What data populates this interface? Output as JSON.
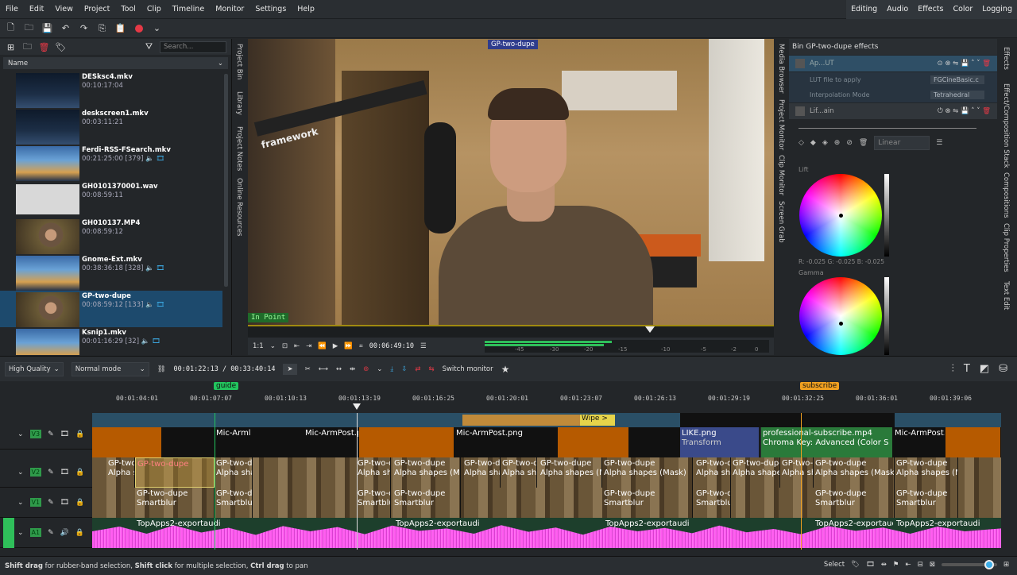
{
  "menu": [
    "File",
    "Edit",
    "View",
    "Project",
    "Tool",
    "Clip",
    "Timeline",
    "Monitor",
    "Settings",
    "Help"
  ],
  "layouts": [
    "Editing",
    "Audio",
    "Effects",
    "Color",
    "Logging"
  ],
  "bin": {
    "search_placeholder": "Search...",
    "name_header": "Name",
    "clips": [
      {
        "name": "DESksc4.mkv",
        "dur": "00:10:17:04",
        "extra": ""
      },
      {
        "name": "deskscreen1.mkv",
        "dur": "00:03:11:21",
        "extra": ""
      },
      {
        "name": "Ferdi-RSS-FSearch.mkv",
        "dur": "00:21:25:00 [379]",
        "extra": "🔈 🎞"
      },
      {
        "name": "GH0101370001.wav",
        "dur": "00:08:59:11",
        "extra": ""
      },
      {
        "name": "GH010137.MP4",
        "dur": "00:08:59:12",
        "extra": ""
      },
      {
        "name": "Gnome-Ext.mkv",
        "dur": "00:38:36:18 [328]",
        "extra": "🔈 🎞"
      },
      {
        "name": "GP-two-dupe",
        "dur": "00:08:59:12 [133]",
        "extra": "🔈 🎞"
      },
      {
        "name": "Ksnip1.mkv",
        "dur": "00:01:16:29 [32]",
        "extra": "🔈 🎞"
      }
    ]
  },
  "left_tabs": [
    "Project Bin",
    "Library",
    "Project Notes",
    "Online Resources"
  ],
  "mid_tabs": [
    "Media Browser",
    "Project Monitor",
    "Clip Monitor",
    "Screen Grab"
  ],
  "right_tabs": [
    "Effects",
    "Effect/Composition Stack",
    "Compositions",
    "Clip Properties",
    "Text Edit"
  ],
  "monitor": {
    "clip_label": "GP-two-dupe",
    "in_point": "In Point",
    "overlay_text": "framework",
    "zoom": "1:1",
    "timecode": "00:06:49:10",
    "meter_scale": [
      "-45",
      "-30",
      "-20",
      "-15",
      "-10",
      "-5",
      "-2",
      "0"
    ]
  },
  "effects": {
    "title": "Bin GP-two-dupe effects",
    "effect1": "Ap...UT",
    "lut_label": "LUT file to apply",
    "lut_value": "FGCineBasic.c",
    "interp_label": "Interpolation Mode",
    "interp_value": "Tetrahedral",
    "effect2": "Lif...ain",
    "mode": "Linear",
    "lift_label": "Lift",
    "lift_values": "R: -0.025  G: -0.025  B: -0.025",
    "gamma_label": "Gamma"
  },
  "timeline_toolbar": {
    "quality": "High Quality",
    "mode": "Normal mode",
    "position": "00:01:22:13 / 00:33:40:14",
    "switch_monitor": "Switch monitor"
  },
  "ruler": {
    "ticks": [
      "00:01:04:01",
      "00:01:07:07",
      "00:01:10:13",
      "00:01:13:19",
      "00:01:16:25",
      "00:01:20:01",
      "00:01:23:07",
      "00:01:26:13",
      "00:01:29:19",
      "00:01:32:25",
      "00:01:36:01",
      "00:01:39:06"
    ],
    "guide1": "guide",
    "guide2": "subscribe"
  },
  "tracks": {
    "names": [
      "V3",
      "V2",
      "V1",
      "A1"
    ],
    "v3_clips": [
      "Mic-Arml",
      "Mic-ArmPost.png",
      "Mic-ArmPost.png",
      "LIKE.png",
      "Transform",
      "professional-subscribe.mp4",
      "Chroma Key: Advanced (Color S",
      "Mic-ArmPost.png"
    ],
    "v3_top": "Wipe >",
    "v2_label": "GP-two-dupe",
    "v2_effect": "Alpha shapes (Mask)",
    "v1_label": "GP-two-dupe",
    "v1_effect": "Smartblur",
    "a1_label": "TopApps2-exportaudi"
  },
  "status": {
    "hint_b1": "Shift drag",
    "hint_t1": " for rubber-band selection, ",
    "hint_b2": "Shift click",
    "hint_t2": " for multiple selection, ",
    "hint_b3": "Ctrl drag",
    "hint_t3": " to pan",
    "select": "Select"
  }
}
